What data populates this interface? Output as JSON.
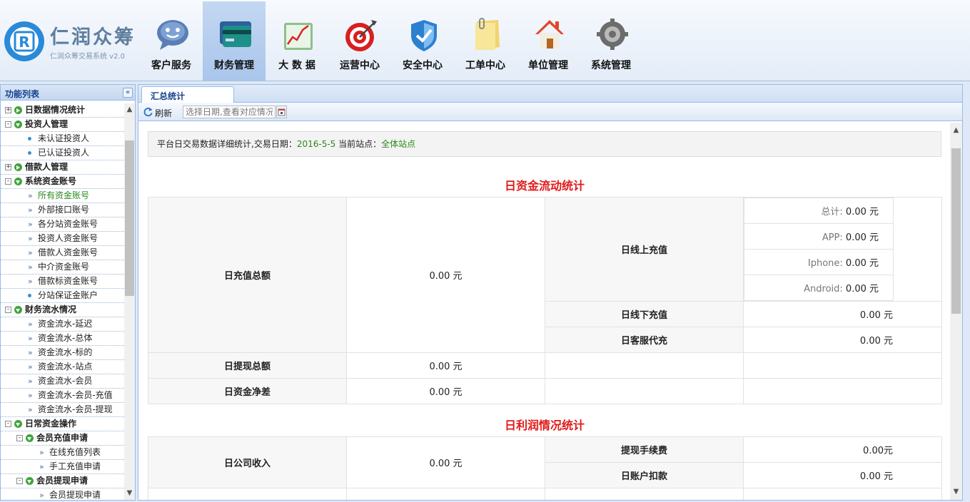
{
  "header": {
    "logo_mark": "R",
    "logo_name": "仁润众筹",
    "logo_sub": "仁润众筹交易系统 v2.0",
    "nav": [
      {
        "label": "客户服务",
        "icon": "chat-bubble-icon"
      },
      {
        "label": "财务管理",
        "icon": "credit-card-icon",
        "active": true
      },
      {
        "label": "大 数 据",
        "icon": "line-chart-icon"
      },
      {
        "label": "运营中心",
        "icon": "target-icon"
      },
      {
        "label": "安全中心",
        "icon": "shield-icon"
      },
      {
        "label": "工单中心",
        "icon": "notepad-icon"
      },
      {
        "label": "单位管理",
        "icon": "house-icon"
      },
      {
        "label": "系统管理",
        "icon": "gears-icon"
      }
    ]
  },
  "sidebar": {
    "title": "功能列表",
    "collapse_glyph": "«",
    "items": [
      {
        "level": 0,
        "label": "日数据情况统计",
        "toggle": "+",
        "state": "closed"
      },
      {
        "level": 0,
        "label": "投资人管理",
        "toggle": "-",
        "state": "open"
      },
      {
        "level": 1,
        "label": "未认证投资人",
        "marker": "dot"
      },
      {
        "level": 1,
        "label": "已认证投资人",
        "marker": "dot"
      },
      {
        "level": 0,
        "label": "借款人管理",
        "toggle": "+",
        "state": "closed"
      },
      {
        "level": 0,
        "label": "系统资金账号",
        "toggle": "-",
        "state": "open"
      },
      {
        "level": 1,
        "label": "所有资金账号",
        "marker": "arrow",
        "selected": true
      },
      {
        "level": 1,
        "label": "外部接口账号",
        "marker": "arrow"
      },
      {
        "level": 1,
        "label": "各分站资金账号",
        "marker": "arrow"
      },
      {
        "level": 1,
        "label": "投资人资金账号",
        "marker": "arrow"
      },
      {
        "level": 1,
        "label": "借款人资金账号",
        "marker": "arrow"
      },
      {
        "level": 1,
        "label": "中介资金账号",
        "marker": "arrow"
      },
      {
        "level": 1,
        "label": "借款标资金账号",
        "marker": "arrow"
      },
      {
        "level": 1,
        "label": "分站保证金账户",
        "marker": "dot"
      },
      {
        "level": 0,
        "label": "财务流水情况",
        "toggle": "-",
        "state": "open"
      },
      {
        "level": 1,
        "label": "资金流水-延迟",
        "marker": "arrow"
      },
      {
        "level": 1,
        "label": "资金流水-总体",
        "marker": "arrow"
      },
      {
        "level": 1,
        "label": "资金流水-标的",
        "marker": "arrow"
      },
      {
        "level": 1,
        "label": "资金流水-站点",
        "marker": "arrow"
      },
      {
        "level": 1,
        "label": "资金流水-会员",
        "marker": "arrow"
      },
      {
        "level": 1,
        "label": "资金流水-会员-充值",
        "marker": "arrow"
      },
      {
        "level": 1,
        "label": "资金流水-会员-提现",
        "marker": "arrow"
      },
      {
        "level": 0,
        "label": "日常资金操作",
        "toggle": "-",
        "state": "open"
      },
      {
        "level": 1,
        "label": "会员充值申请",
        "toggle": "-",
        "state": "open",
        "bold": true
      },
      {
        "level": 2,
        "label": "在线充值列表",
        "marker": "arrow"
      },
      {
        "level": 2,
        "label": "手工充值申请",
        "marker": "arrow"
      },
      {
        "level": 1,
        "label": "会员提现申请",
        "toggle": "-",
        "state": "open",
        "bold": true
      },
      {
        "level": 2,
        "label": "会员提现申请",
        "marker": "arrow"
      }
    ]
  },
  "main": {
    "tab": "汇总统计",
    "toolbar": {
      "refresh": "刷新",
      "date_placeholder": "选择日期,查看对应情况"
    },
    "info": {
      "prefix": "平台日交易数据详细统计,交易日期：",
      "date": "2016-5-5",
      "station_label": " 当前站点：",
      "station": "全体站点"
    },
    "flow": {
      "title": "日资金流动统计",
      "recharge_total_label": "日充值总额",
      "recharge_total_value": "0.00 元",
      "online_label": "日线上充值",
      "online_breakdown": [
        {
          "label": "总计:",
          "value": "0.00 元"
        },
        {
          "label": "APP:",
          "value": "0.00 元"
        },
        {
          "label": "Iphone:",
          "value": "0.00 元"
        },
        {
          "label": "Android:",
          "value": "0.00 元"
        }
      ],
      "offline_label": "日线下充值",
      "offline_value": "0.00 元",
      "service_label": "日客服代充",
      "service_value": "0.00 元",
      "withdraw_label": "日提现总额",
      "withdraw_value": "0.00 元",
      "net_label": "日资金净差",
      "net_value": "0.00 元"
    },
    "profit": {
      "title": "日利润情况统计",
      "income_label": "日公司收入",
      "income_value": "0.00 元",
      "fee_label": "提现手续费",
      "fee_value": "0.00元",
      "deduct_label": "日账户扣款",
      "deduct_value": "0.00 元"
    }
  },
  "colors": {
    "accent_red": "#e01a1a",
    "highlight_green": "#2a8a1a",
    "panel_border": "#99bbe8",
    "header_text": "#15428b"
  }
}
